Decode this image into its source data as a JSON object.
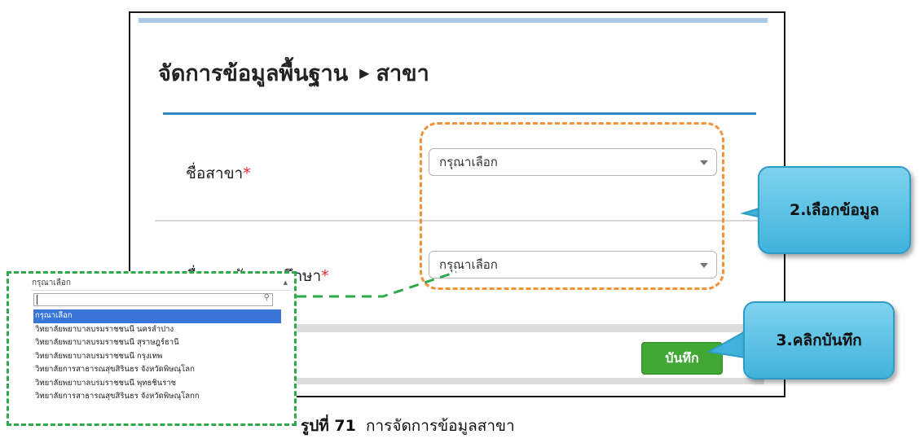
{
  "form": {
    "breadcrumb_parent": "จัดการข้อมูลพื้นฐาน",
    "breadcrumb_current": "สาขา",
    "field1_label": "ชื่อสาขา",
    "field2_label": "ชื่อสถาบันอุดมศึกษา",
    "required_mark": "*",
    "field1_value": "กรุณาเลือก",
    "field2_value": "กรุณาเลือก",
    "save_label": "บันทึก"
  },
  "callouts": {
    "step2": "2.เลือกข้อมูล",
    "step3": "3.คลิกบันทึก"
  },
  "dropdown": {
    "header": "กรุณาเลือก",
    "options": [
      "กรุณาเลือก",
      "วิทยาลัยพยาบาลบรมราชชนนี นครลำปาง",
      "วิทยาลัยพยาบาลบรมราชชนนี สุราษฎร์ธานี",
      "วิทยาลัยพยาบาลบรมราชชนนี กรุงเทพ",
      "วิทยาลัยการสาธารณสุขสิรินธร จังหวัดพิษณุโลก",
      "วิทยาลัยพยาบาลบรมราชชนนี พุทธชินราช",
      "วิทยาลัยการสาธารณสุขสิรินธร จังหวัดพิษณุโลกก"
    ],
    "selected_index": 0
  },
  "caption": {
    "prefix": "รูปที่ 71",
    "text": "การจัดการข้อมูลสาขา"
  },
  "colors": {
    "accent_rule": "#2f8bc1",
    "save_button": "#41a835",
    "highlight_orange": "#f0933a",
    "highlight_green": "#2ea84a",
    "callout": "#3fb3dc",
    "required": "#e0262a"
  }
}
